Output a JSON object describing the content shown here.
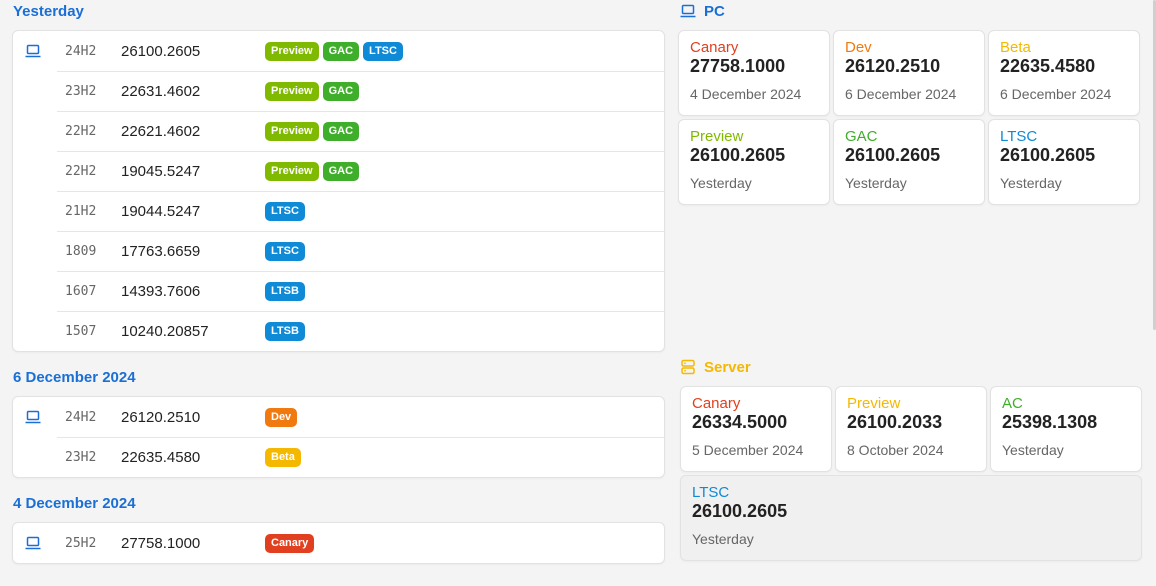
{
  "colors": {
    "accent": "#1a6fd6",
    "canary": "#e0401f",
    "dev": "#f07a10",
    "beta": "#f5b800",
    "preview": "#7fba00",
    "gac": "#3fae2a",
    "ltsc": "#0f8ad6",
    "server": "#f5b800"
  },
  "groups": [
    {
      "title": "Yesterday",
      "rows": [
        {
          "icon": "laptop-icon",
          "version": "24H2",
          "build": "26100.2605",
          "badges": [
            "Preview",
            "GAC",
            "LTSC"
          ]
        },
        {
          "version": "23H2",
          "build": "22631.4602",
          "badges": [
            "Preview",
            "GAC"
          ]
        },
        {
          "version": "22H2",
          "build": "22621.4602",
          "badges": [
            "Preview",
            "GAC"
          ]
        },
        {
          "version": "22H2",
          "build": "19045.5247",
          "badges": [
            "Preview",
            "GAC"
          ]
        },
        {
          "version": "21H2",
          "build": "19044.5247",
          "badges": [
            "LTSC"
          ]
        },
        {
          "version": "1809",
          "build": "17763.6659",
          "badges": [
            "LTSC"
          ]
        },
        {
          "version": "1607",
          "build": "14393.7606",
          "badges": [
            "LTSB"
          ]
        },
        {
          "version": "1507",
          "build": "10240.20857",
          "badges": [
            "LTSB"
          ]
        }
      ]
    },
    {
      "title": "6 December 2024",
      "rows": [
        {
          "icon": "laptop-icon",
          "version": "24H2",
          "build": "26120.2510",
          "badges": [
            "Dev"
          ]
        },
        {
          "version": "23H2",
          "build": "22635.4580",
          "badges": [
            "Beta"
          ]
        }
      ]
    },
    {
      "title": "4 December 2024",
      "rows": [
        {
          "icon": "laptop-icon",
          "version": "25H2",
          "build": "27758.1000",
          "badges": [
            "Canary"
          ]
        }
      ]
    }
  ],
  "pc": {
    "title": "PC",
    "icon": "laptop-icon",
    "tiles": [
      {
        "channel": "Canary",
        "build": "27758.1000",
        "date": "4 December 2024",
        "color": "#e0401f"
      },
      {
        "channel": "Dev",
        "build": "26120.2510",
        "date": "6 December 2024",
        "color": "#f07a10"
      },
      {
        "channel": "Beta",
        "build": "22635.4580",
        "date": "6 December 2024",
        "color": "#f5b800"
      },
      {
        "channel": "Preview",
        "build": "26100.2605",
        "date": "Yesterday",
        "color": "#7fba00"
      },
      {
        "channel": "GAC",
        "build": "26100.2605",
        "date": "Yesterday",
        "color": "#3fae2a"
      },
      {
        "channel": "LTSC",
        "build": "26100.2605",
        "date": "Yesterday",
        "color": "#0f8ad6"
      }
    ]
  },
  "server": {
    "title": "Server",
    "icon": "server-icon",
    "tiles": [
      {
        "channel": "Canary",
        "build": "26334.5000",
        "date": "5 December 2024",
        "color": "#e0401f"
      },
      {
        "channel": "Preview",
        "build": "26100.2033",
        "date": "8 October 2024",
        "color": "#f5b800"
      },
      {
        "channel": "AC",
        "build": "25398.1308",
        "date": "Yesterday",
        "color": "#3fae2a"
      },
      {
        "channel": "LTSC",
        "build": "26100.2605",
        "date": "Yesterday",
        "color": "#0f8ad6"
      }
    ]
  }
}
